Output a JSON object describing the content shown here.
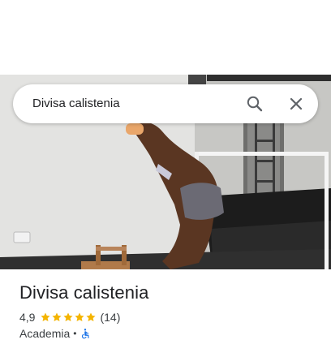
{
  "search": {
    "query": "Divisa calistenia"
  },
  "place": {
    "name": "Divisa calistenia",
    "rating": "4,9",
    "stars": 5,
    "review_count": "(14)",
    "category": "Academia",
    "separator": "•"
  },
  "icons": {
    "search": "search-icon",
    "close": "close-icon",
    "star": "star-icon",
    "accessibility": "wheelchair-accessible-icon"
  },
  "colors": {
    "star": "#f4b400",
    "accessibility": "#1a73e8",
    "text_primary": "#202124",
    "text_secondary": "#3c4043"
  }
}
